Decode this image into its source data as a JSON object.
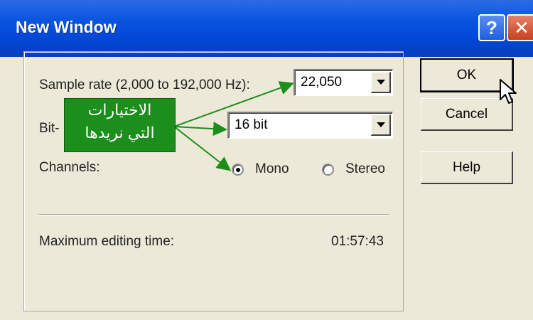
{
  "window": {
    "title": "New Window"
  },
  "titlebar": {
    "help_label": "?",
    "close_label": "✕"
  },
  "form": {
    "sample_rate_label": "Sample rate (2,000 to 192,000 Hz):",
    "sample_rate_value": "22,050",
    "bit_label": "Bit-",
    "bit_value": "16 bit",
    "channels_label": "Channels:",
    "mono_label": "Mono",
    "stereo_label": "Stereo",
    "selected_channel": "Mono",
    "max_time_label": "Maximum editing time:",
    "max_time_value": "01:57:43"
  },
  "buttons": {
    "ok": "OK",
    "cancel": "Cancel",
    "help": "Help"
  },
  "callout": {
    "line1": "الاختيارات",
    "line2": "التي نريدها"
  },
  "colors": {
    "titlebar": "#0a55e0",
    "callout": "#1c8e1c",
    "dialog_bg": "#ece9d8"
  },
  "icons": {
    "help": "question-icon",
    "close": "close-icon",
    "cursor": "mouse-pointer-icon"
  }
}
